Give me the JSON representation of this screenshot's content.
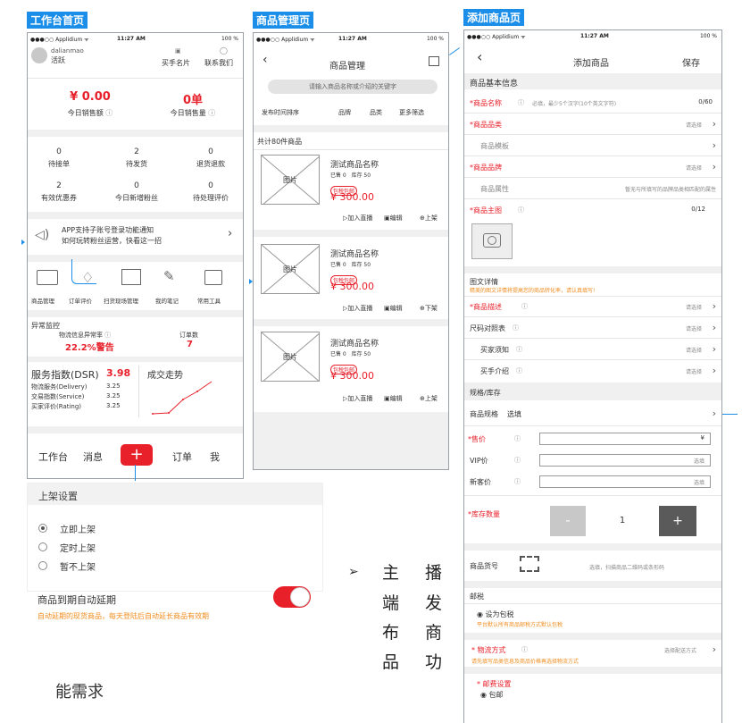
{
  "sections": {
    "home": "工作台首页",
    "product_mgmt": "商品管理页",
    "add_product": "添加商品页"
  },
  "status_bar": {
    "carrier": "●●●○○ Applidium ᯤ",
    "time": "11:27 AM",
    "battery": "100 %"
  },
  "home": {
    "username": "dalianmao",
    "user_status": "活跃",
    "top_links": [
      "买手名片",
      "联系我们"
    ],
    "sales_amount": "¥ 0.00",
    "sales_amount_label": "今日销售额",
    "sales_count": "0单",
    "sales_count_label": "今日销售量",
    "stats": [
      {
        "value": "0",
        "label": "待接单"
      },
      {
        "value": "2",
        "label": "待发货"
      },
      {
        "value": "0",
        "label": "退货退款"
      },
      {
        "value": "2",
        "label": "有效优惠券"
      },
      {
        "value": "0",
        "label": "今日新增粉丝"
      },
      {
        "value": "0",
        "label": "待处理评价"
      }
    ],
    "notice_line1": "APP支持子账号登录功能通知",
    "notice_line2": "如何玩转粉丝运营，快看这一招",
    "tools": [
      "商品管理",
      "订单评价",
      "扫货现场管理",
      "我的笔记",
      "常用工具"
    ],
    "monitor_title": "异常监控",
    "monitor_logistics_label": "物流信息异常率",
    "monitor_logistics_value": "22.2%警告",
    "monitor_orders_label": "订单数",
    "monitor_orders_value": "7",
    "dsr_title": "服务指数(DSR)",
    "dsr_value": "3.98",
    "dsr_items": [
      {
        "label": "物流服务(Delivery)",
        "value": "3.25"
      },
      {
        "label": "交易指数(Service)",
        "value": "3.25"
      },
      {
        "label": "买家评价(Rating)",
        "value": "3.25"
      }
    ],
    "trend_title": "成交走势",
    "nav": [
      "工作台",
      "消息",
      "+",
      "订单",
      "我"
    ]
  },
  "shelf": {
    "title": "上架设置",
    "options": [
      "立即上架",
      "定时上架",
      "暂不上架"
    ],
    "selected_option": "立即上架",
    "auto_extend_label": "商品到期自动延期",
    "auto_extend_desc": "自动延期的现货商品，每天登陆后自动延长商品有效期",
    "auto_extend_on": true
  },
  "product_mgmt": {
    "title": "商品管理",
    "search_placeholder": "请输入商品名称或介绍的关键字",
    "filters": [
      "发布时间排序",
      "品牌",
      "品类",
      "更多筛选"
    ],
    "count_text": "共计80件商品",
    "items": [
      {
        "name": "测试商品名称",
        "sold": "已售 0",
        "stock": "库存 50",
        "tag": "包税包邮",
        "price": "¥ 300.00",
        "image_label": "图片",
        "actions": [
          "加入直播",
          "编辑",
          "上架"
        ]
      },
      {
        "name": "测试商品名称",
        "sold": "已售 0",
        "stock": "库存 50",
        "tag": "包税包邮",
        "price": "¥ 300.00",
        "image_label": "图片",
        "actions": [
          "加入直播",
          "编辑",
          "下架"
        ]
      },
      {
        "name": "测试商品名称",
        "sold": "已售 0",
        "stock": "库存 50",
        "tag": "包税包邮",
        "price": "¥ 300.00",
        "image_label": "图片",
        "actions": [
          "加入直播",
          "编辑",
          "上架"
        ]
      }
    ]
  },
  "add_product": {
    "title": "添加商品",
    "save": "保存",
    "basic_info": "商品基本信息",
    "name_label": "*商品名称",
    "name_placeholder": "必填，最少5个汉字(10个英文字符)",
    "name_counter": "0/60",
    "category_label": "*商品品类",
    "choose": "请选择",
    "template_label": "商品模板",
    "brand_label": "*商品品牌",
    "attr_label": "商品属性",
    "attr_hint": "暂无与所填写的品牌品类相匹配的属性",
    "main_image_label": "*商品主图",
    "main_image_counter": "0/12",
    "detail_title": "图文详情",
    "detail_hint": "精美的图文详情将提高您的商品转化率，请认真填写!",
    "desc_label": "*商品描述",
    "size_label": "尺码对照表",
    "buyer_notice_label": "买家须知",
    "buyer_intro_label": "买手介绍",
    "spec_section": "规格/库存",
    "spec_label": "商品规格",
    "spec_choose": "选填",
    "price_label": "*售价",
    "price_unit": "¥",
    "vip_label": "VIP价",
    "vip_hint": "选填",
    "new_label": "新客价",
    "new_hint": "选填",
    "stock_label": "*库存数量",
    "stock_minus": "-",
    "stock_value": "1",
    "stock_plus": "+",
    "sku_label": "商品货号",
    "sku_hint": "选填，扫描商品二维码或条形码",
    "tax_section": "邮税",
    "tax_option": "设为包税",
    "tax_hint": "平台默认所有商品邮税方式默认包税",
    "logistics_label": "* 物流方式",
    "logistics_choose": "选择配送方式",
    "logistics_hint": "请先填写品类信息及商品价格再选择物流方式",
    "postage_label": "* 邮费设置",
    "postage_option": "包邮"
  },
  "doc_text": {
    "bullet": "➢",
    "col1": [
      "主",
      "端",
      "布",
      "品"
    ],
    "col2": [
      "播",
      "发",
      "商",
      "功"
    ],
    "trailing": "能需求"
  }
}
